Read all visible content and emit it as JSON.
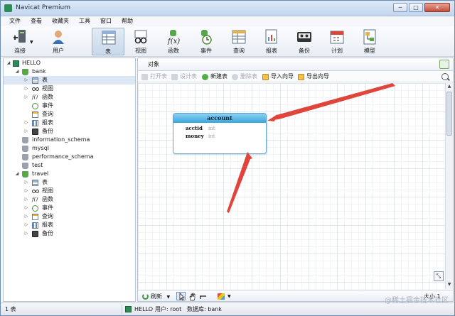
{
  "window": {
    "title": "Navicat Premium",
    "min_label": "─",
    "max_label": "□",
    "close_label": "✕"
  },
  "menu": [
    "文件",
    "查看",
    "收藏夹",
    "工具",
    "窗口",
    "帮助"
  ],
  "toolbar": {
    "connect": "连接",
    "user": "用户",
    "table": "表",
    "view": "视图",
    "function": "函数",
    "event": "事件",
    "query": "查询",
    "report": "报表",
    "backup": "备份",
    "schedule": "计划",
    "model": "模型"
  },
  "tree": {
    "connection": "HELLO",
    "bank": {
      "name": "bank",
      "children": [
        "表",
        "视图",
        "函数",
        "事件",
        "查询",
        "报表",
        "备份"
      ]
    },
    "others": [
      "information_schema",
      "mysql",
      "performance_schema",
      "test"
    ],
    "travel": {
      "name": "travel",
      "children": [
        "表",
        "视图",
        "函数",
        "事件",
        "查询",
        "报表",
        "备份"
      ]
    }
  },
  "objects": {
    "tab_label": "对象",
    "actions": {
      "open": "打开表",
      "design": "设计表",
      "new": "新建表",
      "delete": "删除表",
      "import": "导入向导",
      "export": "导出向导"
    }
  },
  "entity": {
    "name": "account",
    "fields": [
      {
        "name": "acctid",
        "type": "int"
      },
      {
        "name": "money",
        "type": "int"
      }
    ]
  },
  "bottombar": {
    "refresh": "刷新",
    "size": "大小 1"
  },
  "status": {
    "count": "1 表",
    "connection": "HELLO",
    "user": "用户: root",
    "database": "数据库: bank"
  },
  "watermark": "@稀土掘金技术社区",
  "colors": {
    "entity_header": "#38a6dc",
    "arrow": "#e0453c"
  }
}
